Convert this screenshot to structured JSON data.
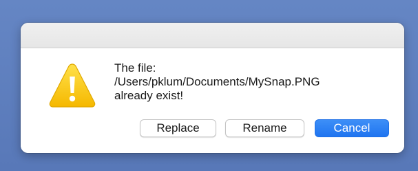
{
  "dialog": {
    "message": {
      "line1": "The file:",
      "line2": "/Users/pklum/Documents/MySnap.PNG",
      "line3": "already exist!"
    },
    "icon": "warning-triangle-icon",
    "buttons": {
      "replace_label": "Replace",
      "rename_label": "Rename",
      "cancel_label": "Cancel"
    },
    "default_button": "cancel"
  },
  "colors": {
    "desktop_background": "#5e7fbf",
    "primary_button": "#2a7ff5",
    "warning_yellow": "#f7c600"
  }
}
